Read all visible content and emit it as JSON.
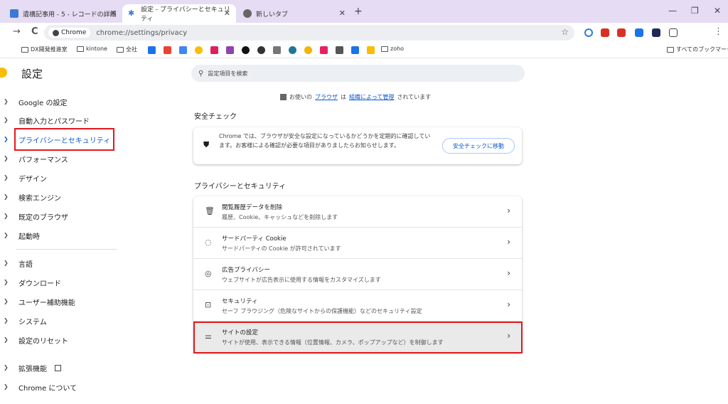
{
  "tabs": [
    {
      "label": "遺構記事用 - 5 - レコードの詳細",
      "favicon_color": "#3a7bd5"
    },
    {
      "label": "設定 - プライバシーとセキュリティ",
      "favicon_color": "#3a7bd5"
    },
    {
      "label": "新しいタブ",
      "favicon_color": "#555555"
    }
  ],
  "tab_close": "✕",
  "new_tab": "+",
  "window": {
    "minimize": "—",
    "maximize": "❐",
    "close": "✕"
  },
  "toolbar": {
    "back": "→",
    "reload": "C",
    "chip": "Chrome",
    "url": "chrome://settings/privacy",
    "star": "☆",
    "menu": "⋮"
  },
  "bookmarks": {
    "items": [
      "DX開発推進室",
      "kintone",
      "全社",
      "zoho"
    ],
    "right": "すべてのブックマーク"
  },
  "sidebar": {
    "title": "設定",
    "items": [
      "Google の設定",
      "自動入力とパスワード",
      "プライバシーとセキュリティ",
      "パフォーマンス",
      "デザイン",
      "検索エンジン",
      "既定のブラウザ",
      "起動時",
      "言語",
      "ダウンロード",
      "ユーザー補助機能",
      "システム",
      "設定のリセット",
      "拡張機能",
      "Chrome について"
    ],
    "selected_index": 2
  },
  "search": {
    "placeholder": "設定項目を検索"
  },
  "managed": {
    "prefix": "お使いの",
    "link1": "ブラウザ",
    "mid": "は",
    "link2": "組織によって管理",
    "suffix": "されています"
  },
  "safety_check": {
    "heading": "安全チェック",
    "text": "Chrome では、ブラウザが安全な設定になっているかどうかを定期的に確認しています。お客様による確認が必要な項目がありましたらお知らせします。",
    "button": "安全チェックに移動"
  },
  "privacy": {
    "heading": "プライバシーとセキュリティ",
    "rows": [
      {
        "title": "閲覧履歴データを削除",
        "subtitle": "履歴、Cookie、キャッシュなどを削除します",
        "icon": "trash-icon"
      },
      {
        "title": "サードパーティ Cookie",
        "subtitle": "サードパーティの Cookie が許可されています",
        "icon": "cookie-icon"
      },
      {
        "title": "広告プライバシー",
        "subtitle": "ウェブサイトが広告表示に使用する情報をカスタマイズします",
        "icon": "ad-privacy-icon"
      },
      {
        "title": "セキュリティ",
        "subtitle": "セーフ ブラウジング（危険なサイトからの保護機能）などのセキュリティ設定",
        "icon": "lock-icon"
      },
      {
        "title": "サイトの設定",
        "subtitle": "サイトが使用、表示できる情報（位置情報、カメラ、ポップアップなど）を制御します",
        "icon": "tune-icon"
      }
    ]
  },
  "colors": {
    "highlight": "#e0191f",
    "accent": "#0b57d0",
    "tabbar": "#e6dcf3"
  }
}
